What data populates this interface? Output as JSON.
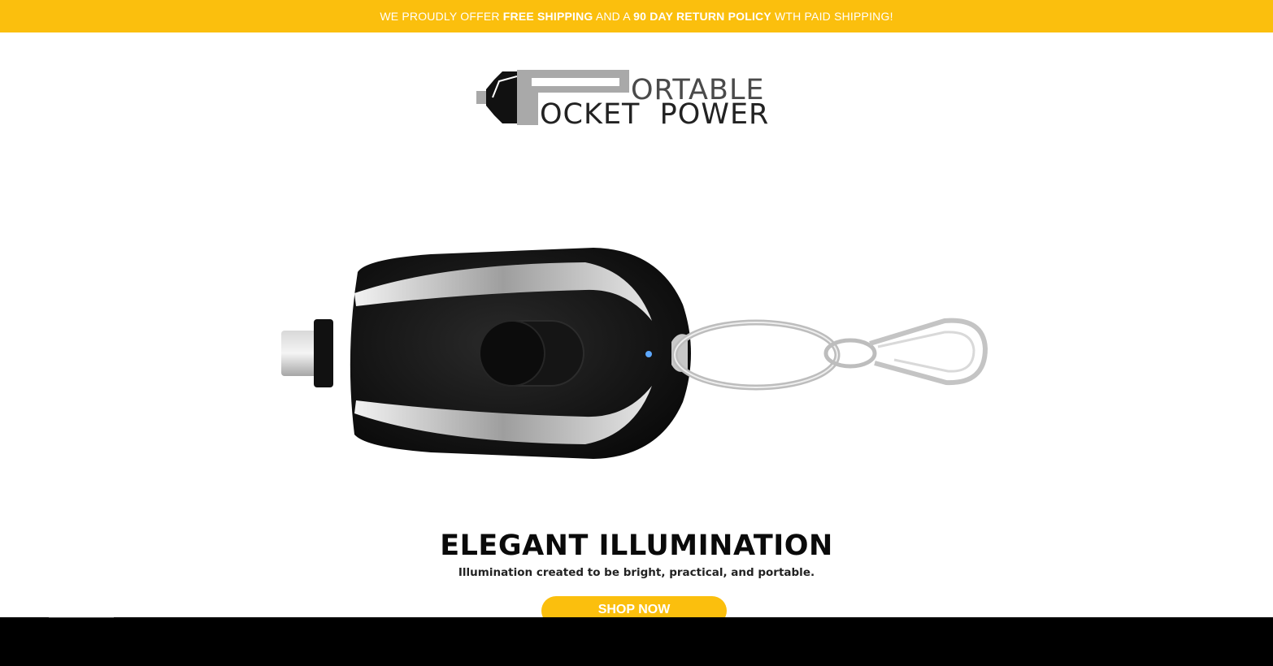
{
  "announcement": {
    "part1": "WE PROUDLY OFFER ",
    "bold1": "FREE SHIPPING",
    "part2": " AND A ",
    "bold2": "90 DAY RETURN POLICY",
    "part3": " WTH PAID SHIPPING!"
  },
  "logo": {
    "line1_rest": "ORTABLE",
    "line2_rest": "OCKET  POWER"
  },
  "hero": {
    "image_subject": "keychain-power-bank-icon"
  },
  "headline": "ELEGANT ILLUMINATION",
  "subheadline": "Illumination created to be bright, practical, and portable.",
  "cta_label": "SHOP NOW",
  "colors": {
    "accent": "#fbbf0d",
    "text_dark": "#0a0a0a",
    "footer": "#000000"
  }
}
